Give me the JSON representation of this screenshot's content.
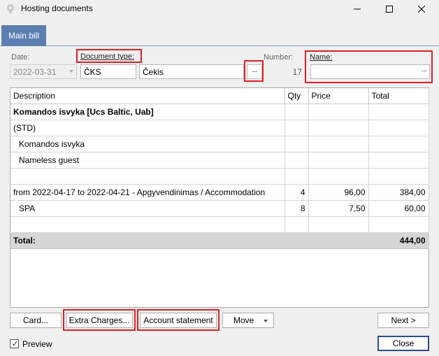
{
  "window": {
    "title": "Hosting documents",
    "min_glyph": "—",
    "max_glyph": "☐",
    "close_glyph": "✕"
  },
  "tabs": [
    {
      "label": "Main bill"
    }
  ],
  "form": {
    "date_label": "Date:",
    "date_value": "2022-03-31",
    "doctype_label": "Document type:",
    "doctype_code": "ČKS",
    "doctype_name": "Čekis",
    "number_label": "Number:",
    "number_value": "17",
    "name_label": "Name:",
    "name_value": "",
    "ellipsis": "···"
  },
  "table": {
    "columns": [
      "Description",
      "Qty",
      "Price",
      "Total"
    ],
    "rows": [
      {
        "description": "Komandos isvyka [Ucs Baltic, Uab]",
        "qty": "",
        "price": "",
        "total": "",
        "bold": true,
        "indent": false
      },
      {
        "description": "(STD)",
        "qty": "",
        "price": "",
        "total": "",
        "bold": false,
        "indent": false
      },
      {
        "description": "Komandos isvyka",
        "qty": "",
        "price": "",
        "total": "",
        "bold": false,
        "indent": true
      },
      {
        "description": "Nameless guest",
        "qty": "",
        "price": "",
        "total": "",
        "bold": false,
        "indent": true
      },
      {
        "description": "",
        "qty": "",
        "price": "",
        "total": "",
        "bold": false,
        "indent": false
      },
      {
        "description": "from 2022-04-17 to 2022-04-21 - Apgyvendinimas / Accommodation",
        "qty": "4",
        "price": "96,00",
        "total": "384,00",
        "bold": false,
        "indent": false
      },
      {
        "description": "SPA",
        "qty": "8",
        "price": "7,50",
        "total": "60,00",
        "bold": false,
        "indent": true
      },
      {
        "description": "",
        "qty": "",
        "price": "",
        "total": "",
        "bold": false,
        "indent": false
      }
    ],
    "total_label": "Total:",
    "total_value": "444,00"
  },
  "buttons": {
    "card": "Card...",
    "extra_charges": "Extra Charges...",
    "account_statement": "Account statement",
    "move": "Move",
    "next": "Next >",
    "close": "Close"
  },
  "preview": {
    "label": "Preview",
    "checked": true
  },
  "colors": {
    "tab_bg": "#5b7fb0",
    "highlight": "#e01f26",
    "total_row_bg": "#d6d6d6"
  }
}
